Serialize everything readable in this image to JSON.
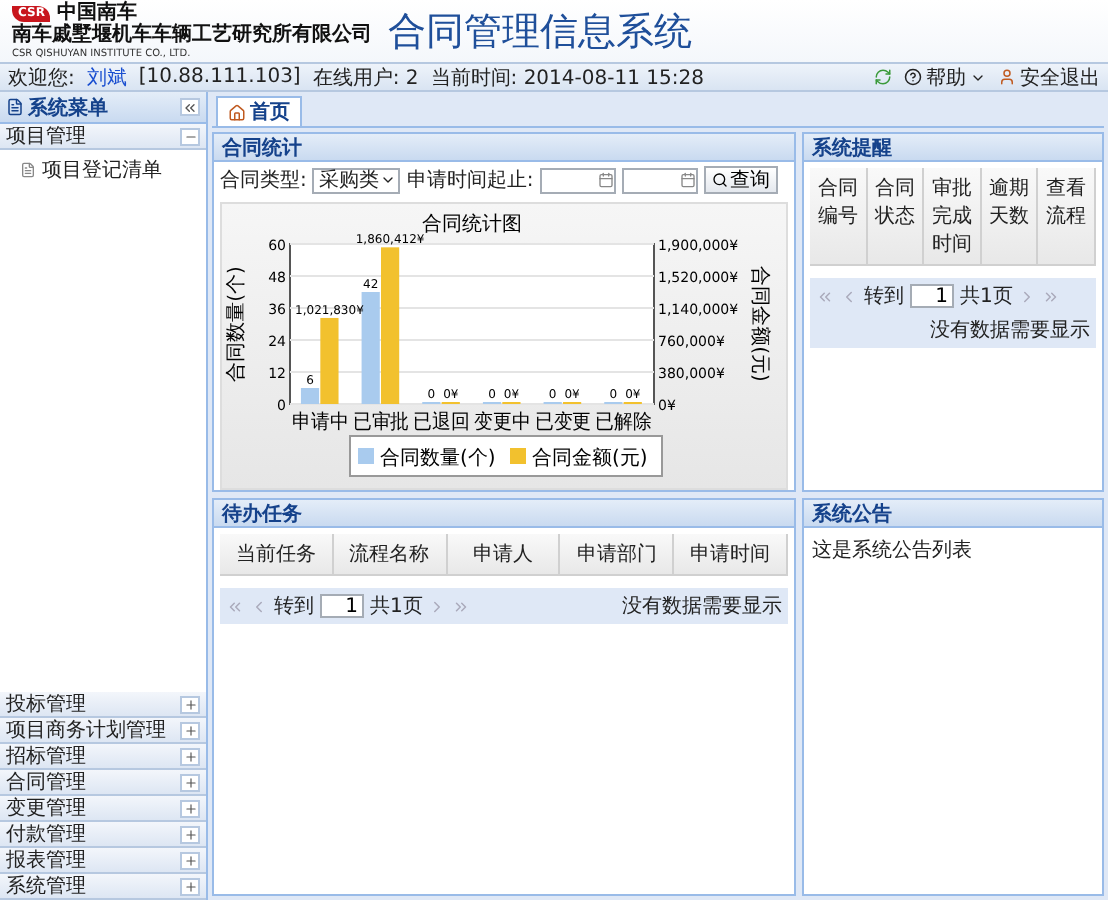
{
  "header": {
    "logo_mark": "CSR",
    "logo_text": "中国南车",
    "company": "南车戚墅堰机车车辆工艺研究所有限公司",
    "company_en": "CSR QISHUYAN INSTITUTE CO., LTD.",
    "title": "合同管理信息系统"
  },
  "info_bar": {
    "welcome_label": "欢迎您:",
    "user": "刘斌",
    "ip": "[10.88.111.103]",
    "online": "在线用户: 2",
    "time": "当前时间: 2014-08-11 15:28",
    "help": "帮助",
    "logout": "安全退出"
  },
  "sidebar": {
    "title": "系统菜单",
    "groups": [
      {
        "label": "项目管理",
        "expanded": true,
        "children": [
          {
            "label": "项目登记清单"
          }
        ]
      },
      {
        "label": "投标管理",
        "expanded": false
      },
      {
        "label": "项目商务计划管理",
        "expanded": false
      },
      {
        "label": "招标管理",
        "expanded": false
      },
      {
        "label": "合同管理",
        "expanded": false
      },
      {
        "label": "变更管理",
        "expanded": false
      },
      {
        "label": "付款管理",
        "expanded": false
      },
      {
        "label": "报表管理",
        "expanded": false
      },
      {
        "label": "系统管理",
        "expanded": false
      }
    ]
  },
  "tabs": [
    {
      "label": "首页",
      "selected": true
    }
  ],
  "stats_panel": {
    "title": "合同统计",
    "type_label": "合同类型:",
    "type_value": "采购类",
    "date_label": "申请时间起止:",
    "search_button": "查询",
    "count_chart": {
      "chart_data": {
        "type": "bar",
        "title": "合同统计图",
        "ylabel": "合同数量(个)",
        "categories": [
          "申请中",
          "已审批",
          "已退回",
          "变更中",
          "已变更",
          "已解除"
        ],
        "series": [
          {
            "name": "合同数量(个)",
            "color": "#a9cbee",
            "values": [
              6,
              42,
              0,
              0,
              0,
              0
            ],
            "value_labels": [
              "6",
              "42",
              "0",
              "0",
              "0",
              "0"
            ]
          }
        ],
        "ylim": [
          0,
          60
        ],
        "yticks": [
          0,
          12,
          24,
          36,
          48,
          60
        ],
        "grid": true
      }
    },
    "amount_chart": {
      "chart_data": {
        "type": "bar",
        "ylabel": "合同金额(元)",
        "series": [
          {
            "name": "合同金额(元)",
            "color": "#f2c12e",
            "values": [
              1021830,
              1860412,
              0,
              0,
              0,
              0
            ],
            "value_labels": [
              "1,021,830¥",
              "1,860,412¥",
              "0¥",
              "0¥",
              "0¥",
              "0¥"
            ]
          }
        ],
        "ylim": [
          0,
          1900000
        ],
        "yticks": [
          {
            "value": 0,
            "label": "0¥"
          },
          {
            "value": 380000,
            "label": "380,000¥"
          },
          {
            "value": 760000,
            "label": "760,000¥"
          },
          {
            "value": 1140000,
            "label": "1,140,000¥"
          },
          {
            "value": 1520000,
            "label": "1,520,000¥"
          },
          {
            "value": 1900000,
            "label": "1,900,000¥"
          }
        ]
      }
    }
  },
  "reminder_panel": {
    "title": "系统提醒",
    "columns": [
      "合同编号",
      "合同状态",
      "审批完成时间",
      "逾期天数",
      "查看流程"
    ],
    "pager": {
      "goto": "转到",
      "page": "1",
      "total": "共1页",
      "empty": "没有数据需要显示"
    }
  },
  "tasks_panel": {
    "title": "待办任务",
    "columns": [
      "当前任务",
      "流程名称",
      "申请人",
      "申请部门",
      "申请时间"
    ],
    "pager": {
      "goto": "转到",
      "page": "1",
      "total": "共1页",
      "empty": "没有数据需要显示"
    }
  },
  "notice_panel": {
    "title": "系统公告",
    "text": "这是系统公告列表"
  }
}
